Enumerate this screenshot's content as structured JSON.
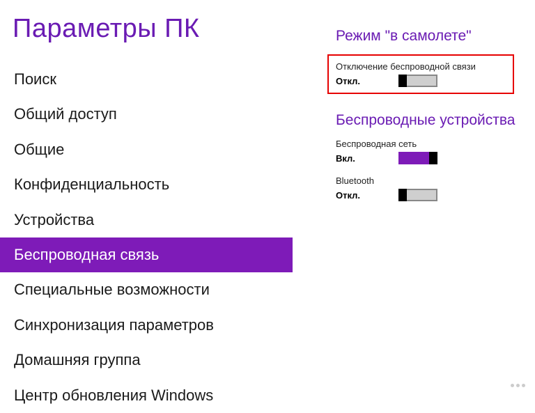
{
  "title": "Параметры ПК",
  "nav": [
    {
      "label": "Поиск",
      "selected": false
    },
    {
      "label": "Общий доступ",
      "selected": false
    },
    {
      "label": "Общие",
      "selected": false
    },
    {
      "label": "Конфиденциальность",
      "selected": false
    },
    {
      "label": "Устройства",
      "selected": false
    },
    {
      "label": "Беспроводная связь",
      "selected": true
    },
    {
      "label": "Специальные возможности",
      "selected": false
    },
    {
      "label": "Синхронизация параметров",
      "selected": false
    },
    {
      "label": "Домашняя группа",
      "selected": false
    },
    {
      "label": "Центр обновления Windows",
      "selected": false
    }
  ],
  "sections": {
    "airplane": {
      "header": "Режим \"в самолете\"",
      "setting": {
        "label": "Отключение беспроводной связи",
        "state_text": "Откл.",
        "on": false
      }
    },
    "wireless": {
      "header": "Беспроводные устройства",
      "settings": [
        {
          "label": "Беспроводная сеть",
          "state_text": "Вкл.",
          "on": true
        },
        {
          "label": "Bluetooth",
          "state_text": "Откл.",
          "on": false
        }
      ]
    }
  }
}
